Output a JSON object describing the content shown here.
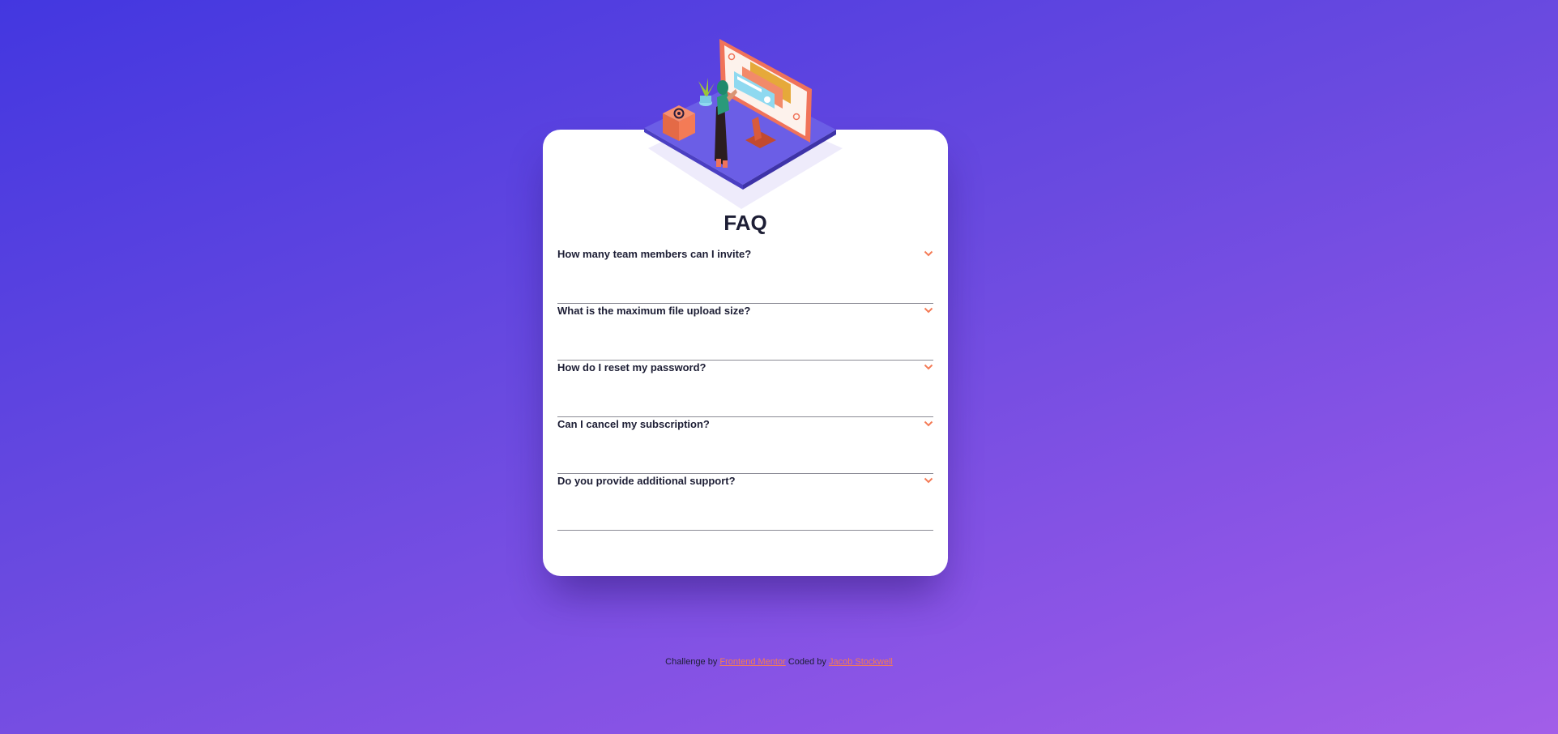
{
  "faq": {
    "title": "FAQ",
    "items": [
      {
        "question": "How many team members can I invite?"
      },
      {
        "question": "What is the maximum file upload size?"
      },
      {
        "question": "How do I reset my password?"
      },
      {
        "question": "Can I cancel my subscription?"
      },
      {
        "question": "Do you provide additional support?"
      }
    ],
    "expand_icon": "chevron-down-icon"
  },
  "footer": {
    "prefix": "Challenge by",
    "challenge_link": "Frontend Mentor",
    "middle": "Coded by",
    "author_link": "Jacob Stockwell"
  },
  "colors": {
    "background_start": "#4337e0",
    "background_end": "#a25ee8",
    "card": "#ffffff",
    "accent": "#f47b56",
    "text": "#1d1e35",
    "divider": "#8a8a94"
  }
}
